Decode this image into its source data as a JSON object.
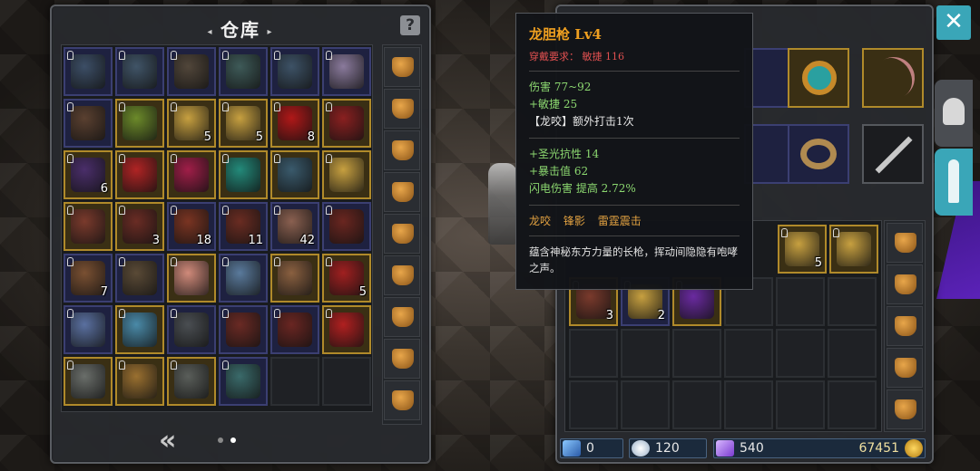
{
  "storage": {
    "title": "仓库",
    "pager_arrow": "«",
    "rows": [
      [
        {
          "r": "blue",
          "c": "#3c4e66",
          "l": true
        },
        {
          "r": "blue",
          "c": "#405467",
          "l": true
        },
        {
          "r": "blue",
          "c": "#51463a",
          "l": true
        },
        {
          "r": "blue",
          "c": "#3e5a58",
          "l": true
        },
        {
          "r": "blue",
          "c": "#3d5266",
          "l": true
        },
        {
          "r": "blue",
          "c": "#8a7a9c",
          "l": true
        }
      ],
      [
        {
          "r": "blue",
          "c": "#5a4030",
          "l": true
        },
        {
          "r": "gold",
          "c": "#6c8a2a",
          "l": true
        },
        {
          "r": "gold",
          "c": "#c7a040",
          "l": true,
          "n": "5"
        },
        {
          "r": "gold",
          "c": "#c7a040",
          "l": true,
          "n": "5"
        },
        {
          "r": "gold",
          "c": "#b01818",
          "l": true,
          "n": "8"
        },
        {
          "r": "gold",
          "c": "#8a2020",
          "l": true
        }
      ],
      [
        {
          "r": "gold",
          "c": "#4a2e6a",
          "l": true,
          "n": "6"
        },
        {
          "r": "gold",
          "c": "#b02424",
          "l": true
        },
        {
          "r": "gold",
          "c": "#a01e48",
          "l": true
        },
        {
          "r": "gold",
          "c": "#238a7a",
          "l": true
        },
        {
          "r": "gold",
          "c": "#3a5a6c",
          "l": true
        },
        {
          "r": "gold",
          "c": "#c7a040",
          "l": true
        }
      ],
      [
        {
          "r": "gold",
          "c": "#7a3a2c",
          "l": true
        },
        {
          "r": "gold",
          "c": "#6a2c24",
          "l": true,
          "n": "3"
        },
        {
          "r": "blue",
          "c": "#7a3422",
          "l": true,
          "n": "18"
        },
        {
          "r": "blue",
          "c": "#6a2c22",
          "l": true,
          "n": "11"
        },
        {
          "r": "blue",
          "c": "#8a6050",
          "l": true,
          "n": "42"
        },
        {
          "r": "blue",
          "c": "#6a2620",
          "l": true
        }
      ],
      [
        {
          "r": "blue",
          "c": "#7a5032",
          "l": true,
          "n": "7"
        },
        {
          "r": "blue",
          "c": "#5a4a36",
          "l": true
        },
        {
          "r": "gold",
          "c": "#d08a7a",
          "l": true
        },
        {
          "r": "blue",
          "c": "#5a7a9c",
          "l": true
        },
        {
          "r": "gold",
          "c": "#8a6040",
          "l": true
        },
        {
          "r": "gold",
          "c": "#a02020",
          "l": true,
          "n": "5"
        }
      ],
      [
        {
          "r": "blue",
          "c": "#5a70a0",
          "l": true
        },
        {
          "r": "gold",
          "c": "#4a8aa8",
          "l": true
        },
        {
          "r": "blue",
          "c": "#4a4e52",
          "l": true
        },
        {
          "r": "blue",
          "c": "#6a2a24",
          "l": true
        },
        {
          "r": "blue",
          "c": "#6a2622",
          "l": true
        },
        {
          "r": "gold",
          "c": "#b02020",
          "l": true
        }
      ],
      [
        {
          "r": "gold",
          "c": "#6a6e6a",
          "l": true
        },
        {
          "r": "gold",
          "c": "#9a7030",
          "l": true
        },
        {
          "r": "gold",
          "c": "#5a5e5a",
          "l": true
        },
        {
          "r": "blue",
          "c": "#3a6a6a",
          "l": true
        },
        {
          "r": "empty"
        },
        {
          "r": "empty"
        }
      ]
    ],
    "side_count": 9
  },
  "tooltip": {
    "name": "龙胆枪  Lv4",
    "requirement": "穿戴要求： 敏捷 116",
    "base_stats": [
      "伤害  77~92",
      "+敏捷  25",
      "【龙咬】额外打击1次"
    ],
    "extra_stats": [
      "+圣光抗性  14",
      "+暴击值  62",
      "闪电伤害  提高  2.72%"
    ],
    "set_skills": [
      "龙咬",
      "锋影",
      "雷霆震击"
    ],
    "description": "蕴含神秘东方力量的长枪，挥动间隐隐有咆哮之声。"
  },
  "bag": {
    "rows": [
      [
        {
          "r": "gold",
          "c": "#7a3a2c",
          "l": true,
          "n": "3"
        },
        {
          "r": "blue",
          "c": "#c7a040",
          "l": true,
          "n": "2"
        },
        {
          "r": "gold",
          "c": "#6a2aa0",
          "l": true
        },
        {
          "r": "empty"
        },
        {
          "r": "empty"
        },
        {
          "r": "empty"
        }
      ],
      [
        {
          "r": "empty"
        },
        {
          "r": "empty"
        },
        {
          "r": "empty"
        },
        {
          "r": "empty"
        },
        {
          "r": "empty"
        },
        {
          "r": "empty"
        }
      ],
      [
        {
          "r": "empty"
        },
        {
          "r": "empty"
        },
        {
          "r": "empty"
        },
        {
          "r": "empty"
        },
        {
          "r": "empty"
        },
        {
          "r": "empty"
        }
      ]
    ],
    "top_items": [
      {
        "c": "#c7a040",
        "n": "5"
      },
      {
        "c": "#c7a040",
        "n": ""
      }
    ]
  },
  "currency": {
    "blue_gem": "0",
    "energy": "120",
    "crystal": "540",
    "gold": "67451"
  },
  "close_label": "✕"
}
